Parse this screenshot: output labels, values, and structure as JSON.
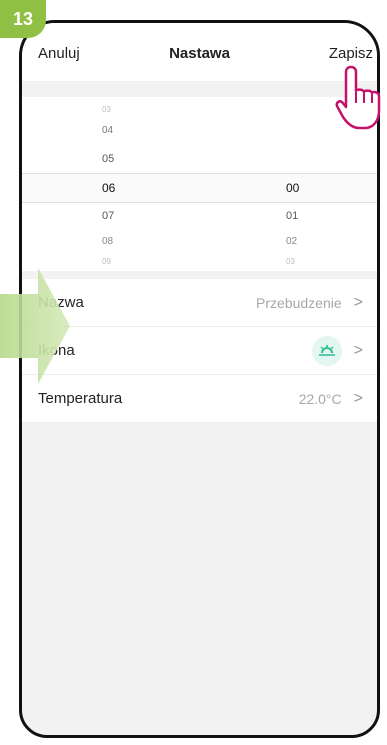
{
  "step": "13",
  "header": {
    "cancel_label": "Anuluj",
    "title": "Nastawa",
    "save_label": "Zapisz"
  },
  "picker": {
    "hours": [
      "03",
      "04",
      "05",
      "06",
      "07",
      "08",
      "09"
    ],
    "minutes": [
      "00",
      "01",
      "02",
      "03"
    ],
    "selected_hour": "06",
    "selected_minute": "00"
  },
  "settings": {
    "name": {
      "label": "Nazwa",
      "value": "Przebudzenie"
    },
    "icon": {
      "label": "Ikona",
      "icon": "sunrise-icon"
    },
    "temperature": {
      "label": "Temperatura",
      "value": "22.0°C"
    }
  },
  "colors": {
    "step_badge": "#8fc043",
    "icon_accent": "#2bbf8e",
    "hand": "#c4116b"
  }
}
